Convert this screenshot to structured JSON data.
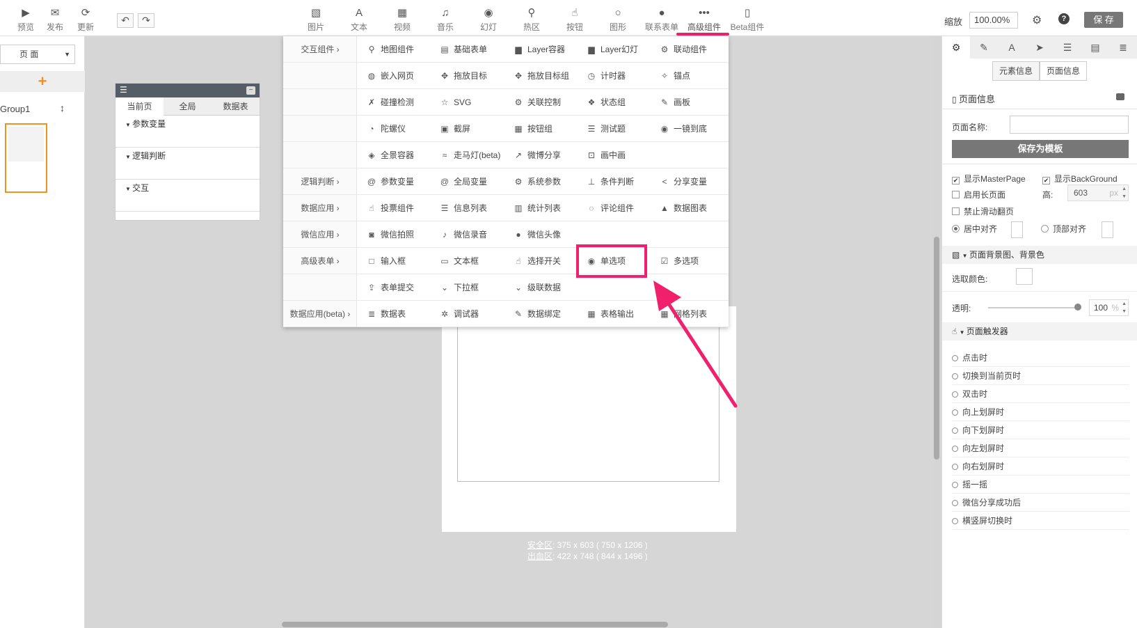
{
  "toolbar": {
    "left": [
      {
        "icon": "▶",
        "label": "预览"
      },
      {
        "icon": "✉",
        "label": "发布"
      },
      {
        "icon": "⟳",
        "label": "更新"
      }
    ],
    "undo": "↶",
    "redo": "↷",
    "center": [
      {
        "icon": "▧",
        "label": "图片"
      },
      {
        "icon": "A",
        "label": "文本"
      },
      {
        "icon": "▦",
        "label": "视频"
      },
      {
        "icon": "♫",
        "label": "音乐"
      },
      {
        "icon": "◉",
        "label": "幻灯"
      },
      {
        "icon": "⚲",
        "label": "热区"
      },
      {
        "icon": "☝",
        "label": "按钮"
      },
      {
        "icon": "○",
        "label": "图形"
      },
      {
        "icon": "●",
        "label": "联系表单"
      },
      {
        "icon": "•••",
        "label": "高级组件"
      },
      {
        "icon": "▯",
        "label": "Beta组件"
      }
    ],
    "zoom_label": "缩放",
    "zoom_value": "100.00%",
    "save_label": "保 存"
  },
  "left_panel": {
    "page_select": "页 面",
    "add": "+",
    "group_label": "Group1",
    "group_handle": "↕"
  },
  "var_panel": {
    "tabs": [
      "当前页",
      "全局",
      "数据表"
    ],
    "sections": [
      "参数变量",
      "逻辑判断",
      "交互"
    ]
  },
  "canvas": {
    "safe_prefix": "安全区",
    "safe_text": ": 375 x 603 ( 750 x 1206 )",
    "bleed_prefix": "出血区",
    "bleed_text": ": 422 x 748 ( 844 x 1496 )"
  },
  "dropdown": {
    "rows": [
      {
        "cat": "交互组件 ›",
        "items": [
          {
            "i": "⚲",
            "t": "地图组件"
          },
          {
            "i": "▤",
            "t": "基础表单"
          },
          {
            "i": "▆",
            "t": "Layer容器"
          },
          {
            "i": "▆",
            "t": "Layer幻灯"
          },
          {
            "i": "⚙",
            "t": "联动组件"
          }
        ]
      },
      {
        "cat": "",
        "items": [
          {
            "i": "◍",
            "t": "嵌入网页"
          },
          {
            "i": "✥",
            "t": "拖放目标"
          },
          {
            "i": "✥",
            "t": "拖放目标组"
          },
          {
            "i": "◷",
            "t": "计时器"
          },
          {
            "i": "✧",
            "t": "锚点"
          }
        ]
      },
      {
        "cat": "",
        "items": [
          {
            "i": "✗",
            "t": "碰撞检测"
          },
          {
            "i": "☆",
            "t": "SVG"
          },
          {
            "i": "⚙",
            "t": "关联控制"
          },
          {
            "i": "❖",
            "t": "状态组"
          },
          {
            "i": "✎",
            "t": "画板"
          }
        ]
      },
      {
        "cat": "",
        "items": [
          {
            "i": "◔",
            "t": "陀螺仪"
          },
          {
            "i": "▣",
            "t": "截屏"
          },
          {
            "i": "▦",
            "t": "按钮组"
          },
          {
            "i": "☰",
            "t": "测试题"
          },
          {
            "i": "◉",
            "t": "一镜到底"
          }
        ]
      },
      {
        "cat": "",
        "items": [
          {
            "i": "◈",
            "t": "全景容器"
          },
          {
            "i": "≈",
            "t": "走马灯(beta)"
          },
          {
            "i": "↗",
            "t": "微博分享"
          },
          {
            "i": "⊡",
            "t": "画中画"
          }
        ]
      },
      {
        "cat": "逻辑判断 ›",
        "items": [
          {
            "i": "@",
            "t": "参数变量"
          },
          {
            "i": "@",
            "t": "全局变量"
          },
          {
            "i": "⚙",
            "t": "系统参数"
          },
          {
            "i": "⊥",
            "t": "条件判断"
          },
          {
            "i": "<",
            "t": "分享变量"
          }
        ]
      },
      {
        "cat": "数据应用 ›",
        "items": [
          {
            "i": "☝",
            "t": "投票组件"
          },
          {
            "i": "☰",
            "t": "信息列表"
          },
          {
            "i": "▥",
            "t": "统计列表"
          },
          {
            "i": "◌",
            "t": "评论组件"
          },
          {
            "i": "▲",
            "t": "数据图表"
          }
        ]
      },
      {
        "cat": "微信应用 ›",
        "items": [
          {
            "i": "◙",
            "t": "微信拍照"
          },
          {
            "i": "♪",
            "t": "微信录音"
          },
          {
            "i": "●",
            "t": "微信头像"
          }
        ]
      },
      {
        "cat": "高级表单 ›",
        "items": [
          {
            "i": "□",
            "t": "输入框"
          },
          {
            "i": "▭",
            "t": "文本框"
          },
          {
            "i": "☝",
            "t": "选择开关"
          },
          {
            "i": "◉",
            "t": "单选项"
          },
          {
            "i": "☑",
            "t": "多选项"
          }
        ]
      },
      {
        "cat": "",
        "items": [
          {
            "i": "⇪",
            "t": "表单提交"
          },
          {
            "i": "⌄",
            "t": "下拉框"
          },
          {
            "i": "⌄",
            "t": "级联数据"
          }
        ]
      },
      {
        "cat": "数据应用(beta) ›",
        "items": [
          {
            "i": "≣",
            "t": "数据表"
          },
          {
            "i": "✲",
            "t": "调试器"
          },
          {
            "i": "✎",
            "t": "数据绑定"
          },
          {
            "i": "▦",
            "t": "表格输出"
          },
          {
            "i": "▦",
            "t": "网格列表"
          }
        ]
      }
    ]
  },
  "right_panel": {
    "icons": [
      "⚙",
      "✎",
      "A",
      "➤",
      "☰",
      "▤",
      "≣"
    ],
    "seg": [
      "元素信息",
      "页面信息"
    ],
    "page_info_title": "页面信息",
    "page_name_label": "页面名称:",
    "save_template": "保存为模板",
    "show_master": "显示MasterPage",
    "show_bg": "显示BackGround",
    "long_page": "启用长页面",
    "height_label": "高:",
    "height_value": "603",
    "height_unit": "px",
    "disable_swipe": "禁止滑动翻页",
    "center_align": "居中对齐",
    "top_align": "顶部对齐",
    "bg_title": "页面背景图、背景色",
    "pick_color": "选取颜色:",
    "opacity_label": "透明:",
    "opacity_value": "100",
    "opacity_unit": "%",
    "trigger_title": "页面触发器",
    "triggers": [
      "点击时",
      "切换到当前页时",
      "双击时",
      "向上划屏时",
      "向下划屏时",
      "向左划屏时",
      "向右划屏时",
      "摇一摇",
      "微信分享成功后",
      "横竖屏切换时"
    ]
  },
  "colors": {
    "accent": "#f0206c",
    "save_btn": "#777777",
    "orange": "#f0931e",
    "panel_dark": "#555e66"
  }
}
